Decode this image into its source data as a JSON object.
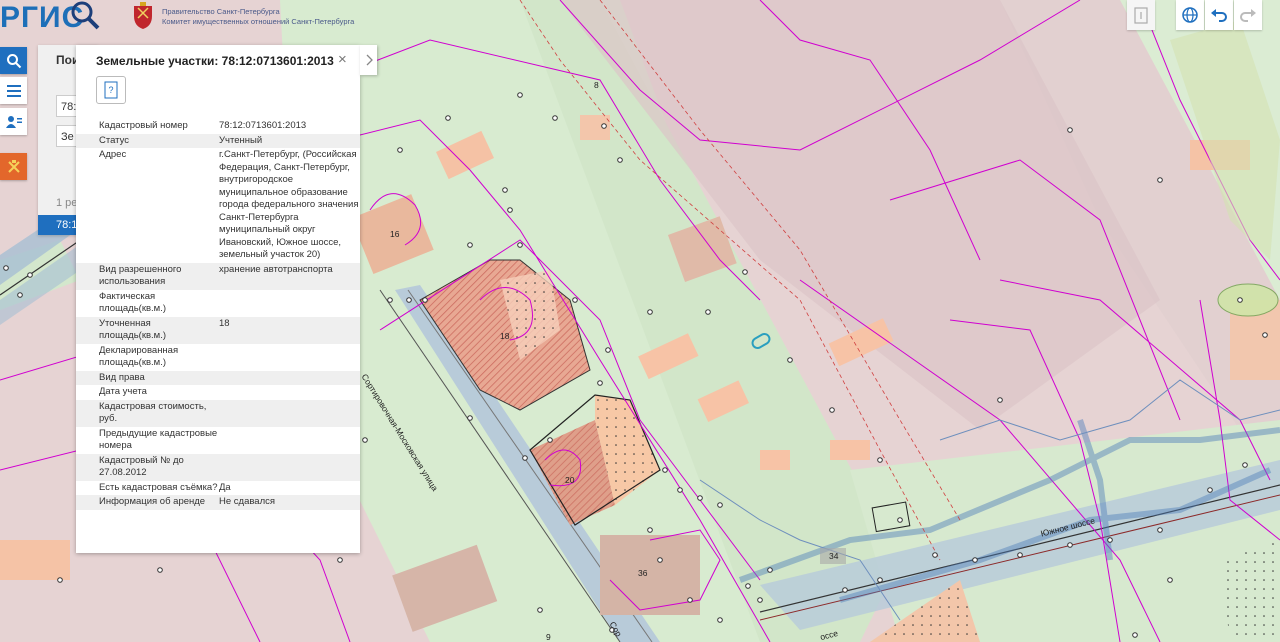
{
  "header": {
    "logo_text": "РГИС",
    "gov_line1": "Правительство Санкт-Петербурга",
    "gov_line2": "Комитет имущественных отношений Санкт-Петербурга"
  },
  "search": {
    "title": "Пои",
    "field1": "78:",
    "field2": "Зе",
    "count": "1 ре",
    "result": "78:1"
  },
  "card": {
    "title": "Земельные участки: 78:12:0713601:2013",
    "close_label": "×",
    "doc_label": "?",
    "rows": [
      {
        "k": "Кадастровый номер",
        "v": "78:12:0713601:2013"
      },
      {
        "k": "Статус",
        "v": "Учтенный"
      },
      {
        "k": "Адрес",
        "v": "г.Санкт-Петербург, (Российская Федерация, Санкт-Петербург, внутригородское муниципальное образование города федерального значения Санкт-Петербурга муниципальный округ Ивановский, Южное шоссе, земельный участок 20)"
      },
      {
        "k": "Вид разрешенного использования",
        "v": "хранение автотранспорта"
      },
      {
        "k": "Фактическая площадь(кв.м.)",
        "v": ""
      },
      {
        "k": "Уточненная площадь(кв.м.)",
        "v": "18"
      },
      {
        "k": "Декларированная площадь(кв.м.)",
        "v": ""
      },
      {
        "k": "Вид права",
        "v": ""
      },
      {
        "k": "Дата учета",
        "v": ""
      },
      {
        "k": "Кадастровая стоимость, руб.",
        "v": ""
      },
      {
        "k": "Предыдущие кадастровые номера",
        "v": ""
      },
      {
        "k": "Кадастровый № до 27.08.2012",
        "v": ""
      },
      {
        "k": "Есть кадастровая съёмка?",
        "v": "Да"
      },
      {
        "k": "Информация об аренде",
        "v": "Не сдавался"
      }
    ]
  },
  "map": {
    "labels": [
      "16",
      "18",
      "20",
      "34",
      "36",
      "8",
      "9",
      "Сортировочная-Московская улица",
      "Южное шоссе",
      "оссе",
      "Сор"
    ]
  },
  "colors": {
    "accent": "#1f6fbf",
    "parcel_border": "#d400d4",
    "building": "#f7c3a6",
    "green": "#cfe8c8",
    "road": "#a6c1d6"
  }
}
